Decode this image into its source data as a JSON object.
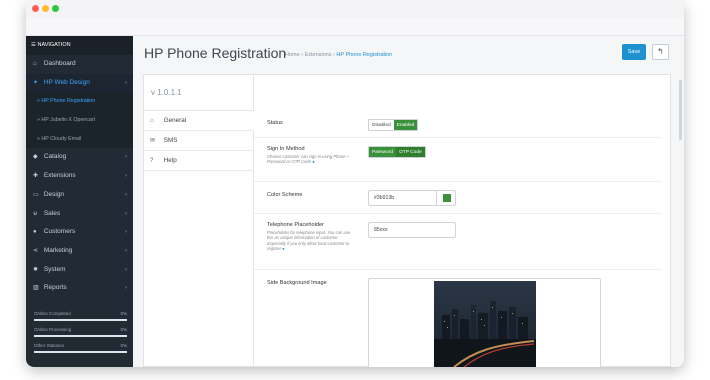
{
  "sidebar": {
    "nav_title": "NAVIGATION",
    "items": [
      {
        "label": "Dashboard",
        "icon": "dashboard-icon",
        "glyph": "⌂",
        "has_children": false
      },
      {
        "label": "HP Web Design",
        "icon": "puzzle-icon",
        "glyph": "✦",
        "has_children": true,
        "active": true
      }
    ],
    "subitems": [
      {
        "label": "» HP Phone Registration",
        "active": true
      },
      {
        "label": "» HP Jubelio X Opencart",
        "active": false
      },
      {
        "label": "» HP Cloudy Email",
        "active": false
      }
    ],
    "more_items": [
      {
        "label": "Catalog",
        "icon": "tag-icon",
        "glyph": "◆"
      },
      {
        "label": "Extensions",
        "icon": "puzzle-piece-icon",
        "glyph": "✚"
      },
      {
        "label": "Design",
        "icon": "monitor-icon",
        "glyph": "▭"
      },
      {
        "label": "Sales",
        "icon": "cart-icon",
        "glyph": "⊌"
      },
      {
        "label": "Customers",
        "icon": "user-icon",
        "glyph": "●"
      },
      {
        "label": "Marketing",
        "icon": "share-icon",
        "glyph": "⋖"
      },
      {
        "label": "System",
        "icon": "gear-icon",
        "glyph": "✹"
      },
      {
        "label": "Reports",
        "icon": "bar-chart-icon",
        "glyph": "▥"
      }
    ],
    "stats": [
      {
        "label": "Orders Completed",
        "percent": "0%"
      },
      {
        "label": "Orders Processing",
        "percent": "0%"
      },
      {
        "label": "Other Statuses",
        "percent": "0%"
      }
    ]
  },
  "header": {
    "title": "HP Phone Registration",
    "breadcrumb": {
      "home": "Home",
      "extensions": "Extensions",
      "current": "HP Phone Registration",
      "separator": "›"
    },
    "save_label": "Save",
    "back_glyph": "↰"
  },
  "panel": {
    "version": "v 1.0.1.1",
    "tabs": [
      {
        "label": "General",
        "icon": "home-icon",
        "glyph": "⌂",
        "active": true
      },
      {
        "label": "SMS",
        "icon": "envelope-icon",
        "glyph": "✉",
        "active": false
      },
      {
        "label": "Help",
        "icon": "question-icon",
        "glyph": "?",
        "active": false
      }
    ],
    "status": {
      "label": "Status",
      "off": "Disabled",
      "on": "Enabled"
    },
    "sign_in": {
      "label": "Sign In Method",
      "help": "Choose customer can sign in using Phone + Password or OTP Code",
      "opt1": "Password",
      "opt2": "OTP Code"
    },
    "color": {
      "label": "Color Scheme",
      "value": "#3b913b"
    },
    "phone": {
      "label": "Telephone Placeholder",
      "help": "Placeholder for telephone input. You can use this as unique information of customer. Especially if you only allow local customer to register",
      "value": "85xxx"
    },
    "side_bg": {
      "label": "Side Background Image"
    }
  },
  "colors": {
    "accent": "#1e91cf",
    "enabled": "#3b913b",
    "sidebar": "#222b34",
    "active_link": "#3aa6ff"
  }
}
